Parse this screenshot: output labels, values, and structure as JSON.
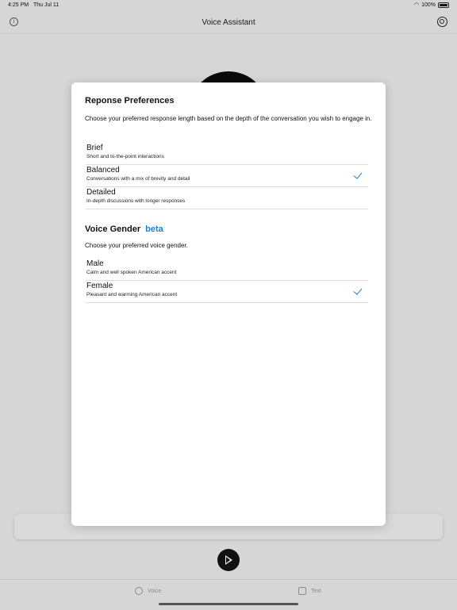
{
  "status_bar": {
    "time": "4:25 PM",
    "date": "Thu Jul 11",
    "battery": "100%"
  },
  "navbar": {
    "title": "Voice Assistant",
    "info_icon": "info-icon",
    "settings_icon": "settings-icon"
  },
  "response_prefs": {
    "title": "Reponse Preferences",
    "description": "Choose your preferred response length based on the depth of the conversation you wish to engage in.",
    "options": [
      {
        "name": "Brief",
        "sub": "Short and to-the-point interactions",
        "selected": false
      },
      {
        "name": "Balanced",
        "sub": "Conversations with a mix of brevity and detail",
        "selected": true
      },
      {
        "name": "Detailed",
        "sub": "In-depth discussions with longer responses",
        "selected": false
      }
    ]
  },
  "voice_gender": {
    "title": "Voice Gender",
    "badge": "beta",
    "description": "Choose your preferred voice gender.",
    "options": [
      {
        "name": "Male",
        "sub": "Calm and well spoken American accent",
        "selected": false
      },
      {
        "name": "Female",
        "sub": "Pleasant and warming American accent",
        "selected": true
      }
    ]
  },
  "tabbar": {
    "voice_label": "Voice",
    "text_label": "Text"
  },
  "colors": {
    "accent": "#1a7fd4",
    "background_dim": "#d6d6d6",
    "modal": "#ffffff"
  }
}
